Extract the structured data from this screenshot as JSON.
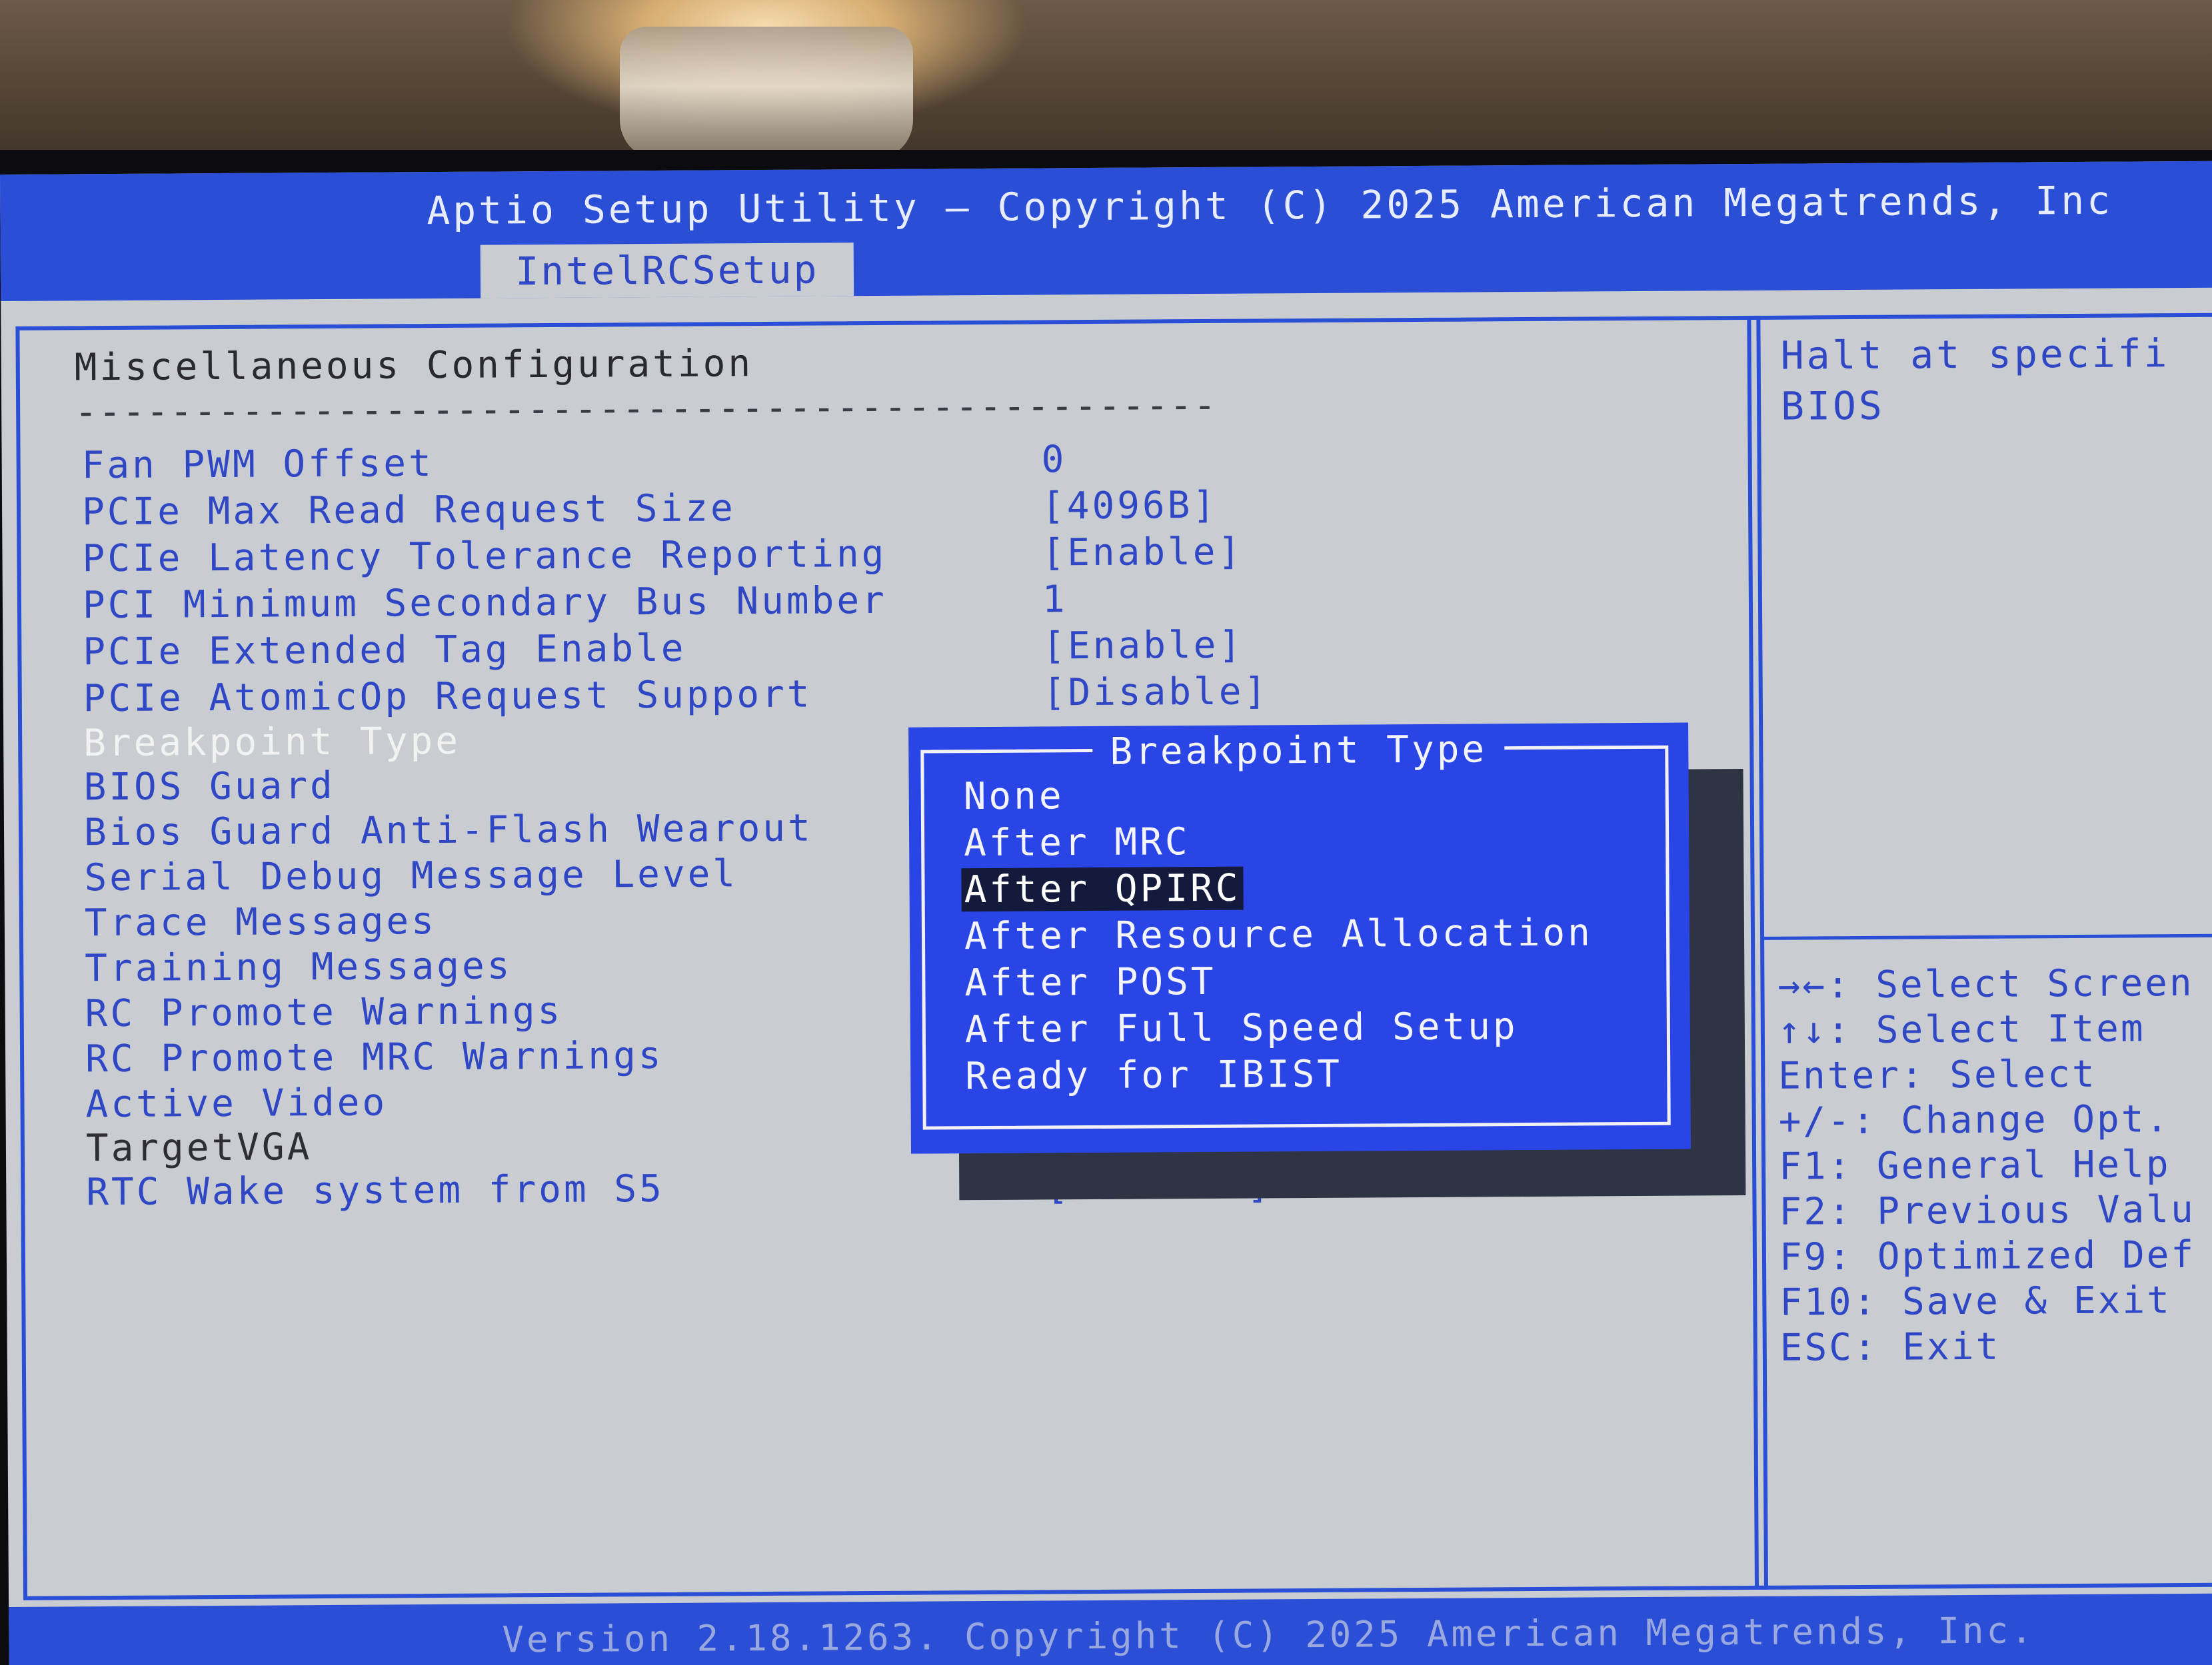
{
  "header": {
    "title": "Aptio Setup Utility – Copyright (C) 2025 American Megatrends, Inc",
    "tab": "IntelRCSetup"
  },
  "section": {
    "title": "Miscellaneous Configuration",
    "divider": "------------------------------------------------"
  },
  "settings": [
    {
      "label": "Fan PWM Offset",
      "value": "0"
    },
    {
      "label": "PCIe Max Read Request Size",
      "value": "[4096B]"
    },
    {
      "label": "PCIe Latency Tolerance Reporting",
      "value": "[Enable]"
    },
    {
      "label": "PCI Minimum Secondary Bus Number",
      "value": "1"
    },
    {
      "label": "PCIe Extended Tag Enable",
      "value": "[Enable]"
    },
    {
      "label": "PCIe AtomicOp Request Support",
      "value": "[Disable]"
    },
    {
      "label": "Breakpoint Type",
      "value": ""
    },
    {
      "label": "BIOS Guard",
      "value": ""
    },
    {
      "label": "Bios Guard Anti-Flash Wearout",
      "value": ""
    },
    {
      "label": "Serial Debug Message Level",
      "value": ""
    },
    {
      "label": "Trace Messages",
      "value": ""
    },
    {
      "label": "Training Messages",
      "value": ""
    },
    {
      "label": "RC Promote Warnings",
      "value": ""
    },
    {
      "label": "RC Promote MRC Warnings",
      "value": ""
    },
    {
      "label": "Active Video",
      "value": ""
    },
    {
      "label": "TargetVGA",
      "value": ""
    },
    {
      "label": "RTC Wake system from S5",
      "value": "[Disable]"
    }
  ],
  "help": {
    "text": "Halt at specifi\nBIOS",
    "keys": [
      "→←: Select Screen",
      "↑↓: Select Item",
      "Enter: Select",
      "+/-: Change Opt.",
      "F1: General Help",
      "F2: Previous Valu",
      "F9: Optimized Def",
      "F10: Save & Exit",
      "ESC: Exit"
    ]
  },
  "popup": {
    "title": "Breakpoint Type",
    "options": [
      "None",
      "After MRC",
      "After QPIRC",
      "After Resource Allocation",
      "After POST",
      "After Full Speed Setup",
      "Ready for IBIST"
    ],
    "selected": "After QPIRC"
  },
  "footer": {
    "text": "Version 2.18.1263. Copyright (C) 2025 American Megatrends, Inc."
  },
  "colors": {
    "screen_bg": "#c9cdd1",
    "accent_blue": "#2b4ed6",
    "item_text": "#2f47c4",
    "popup_bg": "#2a45e6",
    "highlight": "#141a3c"
  }
}
